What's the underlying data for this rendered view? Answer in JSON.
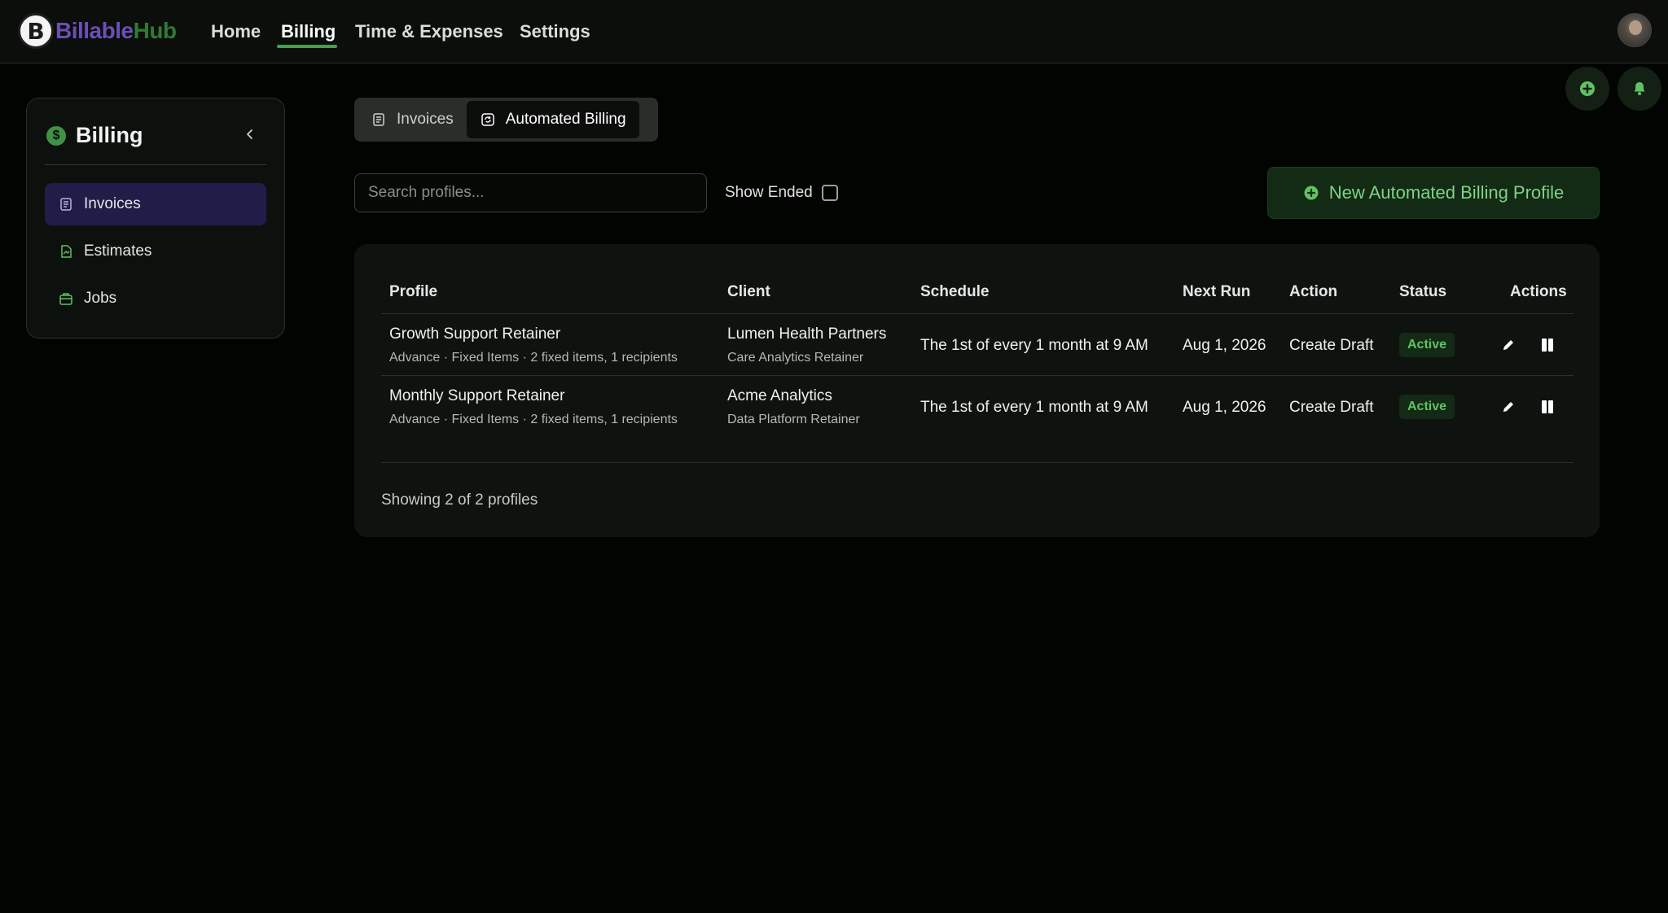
{
  "app": {
    "brand_part1": "Billable",
    "brand_part2": "Hub",
    "brand_letter": "B"
  },
  "nav": {
    "items": [
      {
        "label": "Home"
      },
      {
        "label": "Billing"
      },
      {
        "label": "Time & Expenses"
      },
      {
        "label": "Settings"
      }
    ],
    "active": "Billing"
  },
  "sidebar": {
    "title": "Billing",
    "title_icon": "dollar-icon",
    "items": [
      {
        "label": "Invoices",
        "icon": "invoice-icon",
        "active": true
      },
      {
        "label": "Estimates",
        "icon": "estimate-icon",
        "active": false
      },
      {
        "label": "Jobs",
        "icon": "briefcase-icon",
        "active": false
      }
    ]
  },
  "tabs": {
    "items": [
      {
        "label": "Invoices",
        "icon": "invoice-icon"
      },
      {
        "label": "Automated Billing",
        "icon": "refresh-icon"
      }
    ],
    "active": "Automated Billing"
  },
  "toolbar": {
    "search_placeholder": "Search profiles...",
    "show_ended_label": "Show Ended",
    "show_ended_checked": false,
    "new_button_label": "New Automated Billing Profile"
  },
  "table": {
    "headers": [
      "Profile",
      "Client",
      "Schedule",
      "Next Run",
      "Action",
      "Status",
      "Actions"
    ],
    "rows": [
      {
        "profile": "Growth Support Retainer",
        "profile_sub": "Advance · Fixed Items · 2 fixed items, 1 recipients",
        "client": "Lumen Health Partners",
        "client_sub": "Care Analytics Retainer",
        "schedule": "The 1st of every 1 month at 9 AM",
        "next_run": "Aug 1, 2026",
        "action": "Create Draft",
        "status": "Active"
      },
      {
        "profile": "Monthly Support Retainer",
        "profile_sub": "Advance · Fixed Items · 2 fixed items, 1 recipients",
        "client": "Acme Analytics",
        "client_sub": "Data Platform Retainer",
        "schedule": "The 1st of every 1 month at 9 AM",
        "next_run": "Aug 1, 2026",
        "action": "Create Draft",
        "status": "Active"
      }
    ],
    "footer": "Showing 2 of 2 profiles"
  },
  "colors": {
    "accent_green": "#4c9a52",
    "active_purple": "#211c48",
    "status_active": "#5fc265",
    "background": "#020402"
  }
}
